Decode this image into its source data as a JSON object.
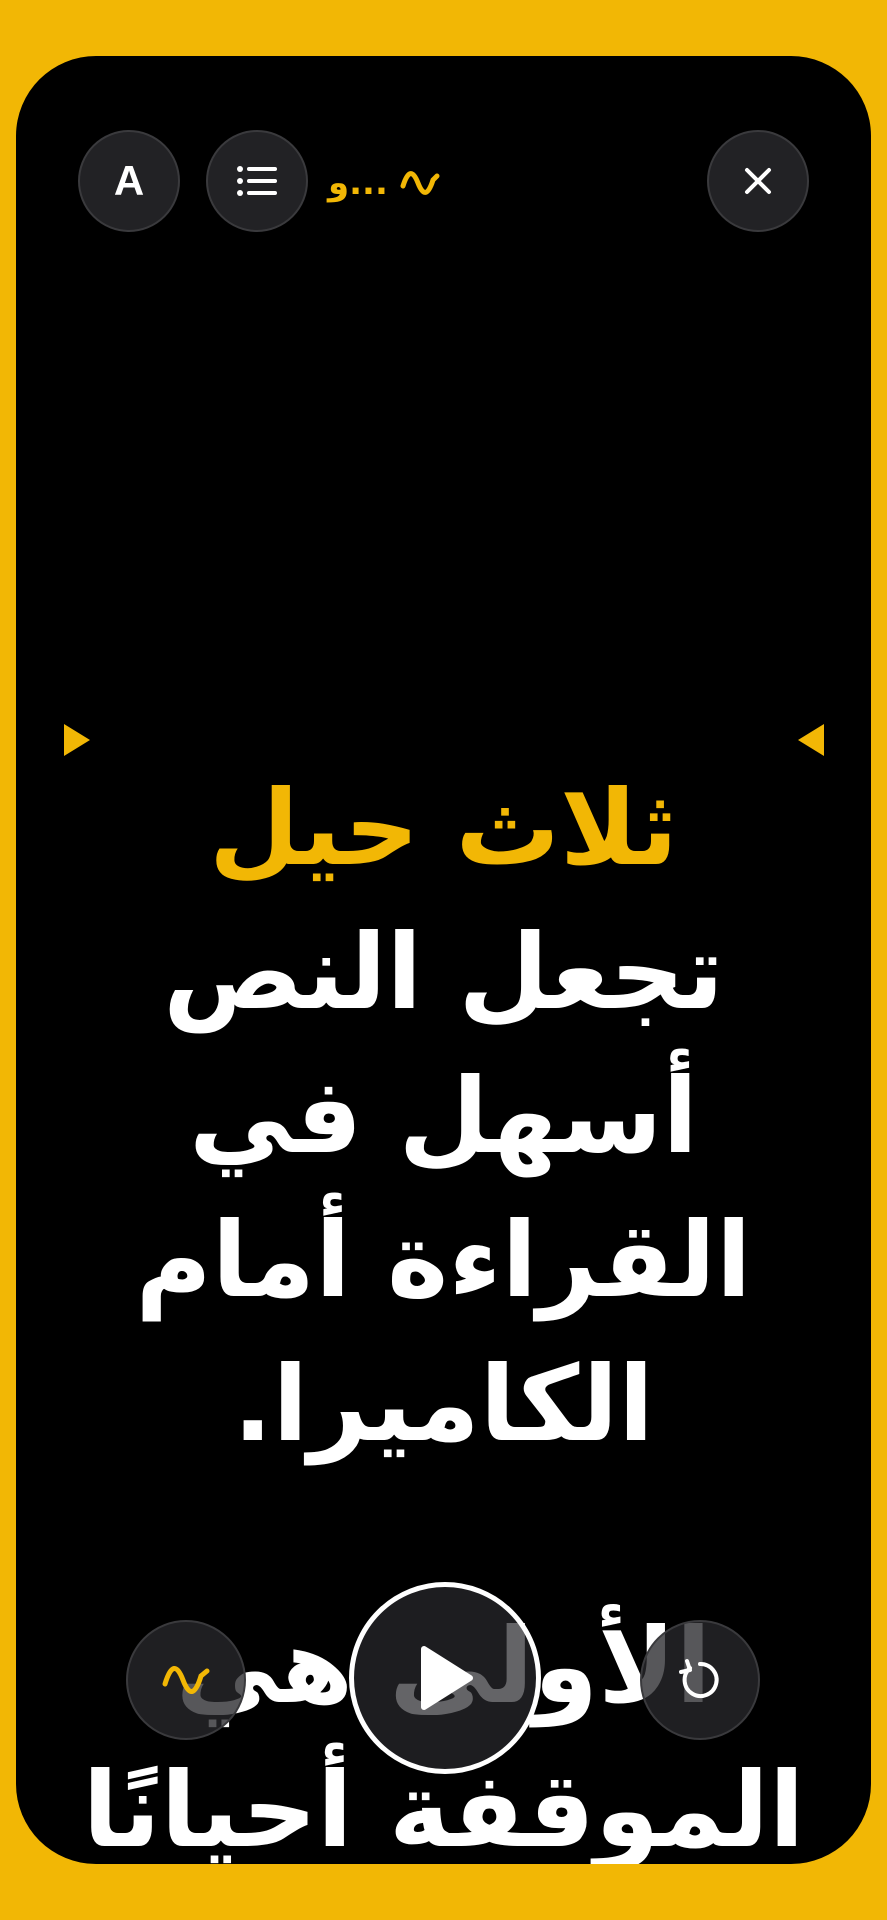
{
  "app": {
    "voice_label": "و...",
    "accent_color": "#f2b705"
  },
  "header": {
    "font_button": {
      "label": "A",
      "icon": "font-size-icon"
    },
    "list_button": {
      "icon": "list-icon"
    },
    "voice_icon": "waveform-icon",
    "close_button": {
      "icon": "close-icon"
    }
  },
  "script": {
    "lines": [
      {
        "text": "ثلاث حيل",
        "highlight": true
      },
      {
        "text": "تجعل النص",
        "highlight": false
      },
      {
        "text": "أسهل في",
        "highlight": false
      },
      {
        "text": "القراءة أمام",
        "highlight": false
      },
      {
        "text": "الكاميرا.",
        "highlight": false
      },
      {
        "text": "الأولى هي",
        "highlight": false
      },
      {
        "text": "الموقفة أحيانًا",
        "highlight": false
      }
    ]
  },
  "reading_markers": {
    "icon": "triangle-marker-icon"
  },
  "controls": {
    "voice_button_icon": "waveform-icon",
    "play_button_icon": "play-icon",
    "restart_button_icon": "restart-icon"
  }
}
